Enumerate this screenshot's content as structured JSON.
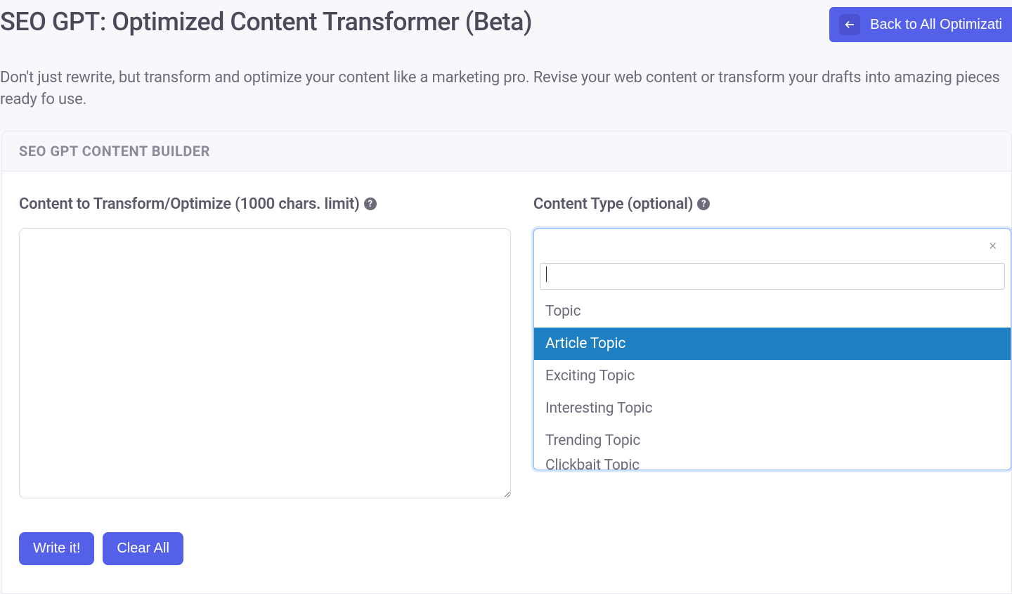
{
  "header": {
    "title": "SEO GPT: Optimized Content Transformer (Beta)",
    "back_label": "Back to All Optimizati"
  },
  "description": "Don't just rewrite, but transform and optimize your content like a marketing pro. Revise your web content or transform your drafts into amazing pieces ready fo use.",
  "card": {
    "header": "SEO GPT CONTENT BUILDER"
  },
  "left": {
    "label": "Content to Transform/Optimize (1000 chars. limit)",
    "value": ""
  },
  "right": {
    "label": "Content Type (optional) ",
    "search_value": "",
    "clear_symbol": "×",
    "options": [
      {
        "label": "Topic",
        "highlighted": false
      },
      {
        "label": "Article Topic",
        "highlighted": true
      },
      {
        "label": "Exciting Topic",
        "highlighted": false
      },
      {
        "label": "Interesting Topic",
        "highlighted": false
      },
      {
        "label": "Trending Topic",
        "highlighted": false
      },
      {
        "label": "Clickbait Topic",
        "highlighted": false,
        "partial": true
      }
    ]
  },
  "buttons": {
    "write": "Write it!",
    "clear": "Clear All"
  }
}
